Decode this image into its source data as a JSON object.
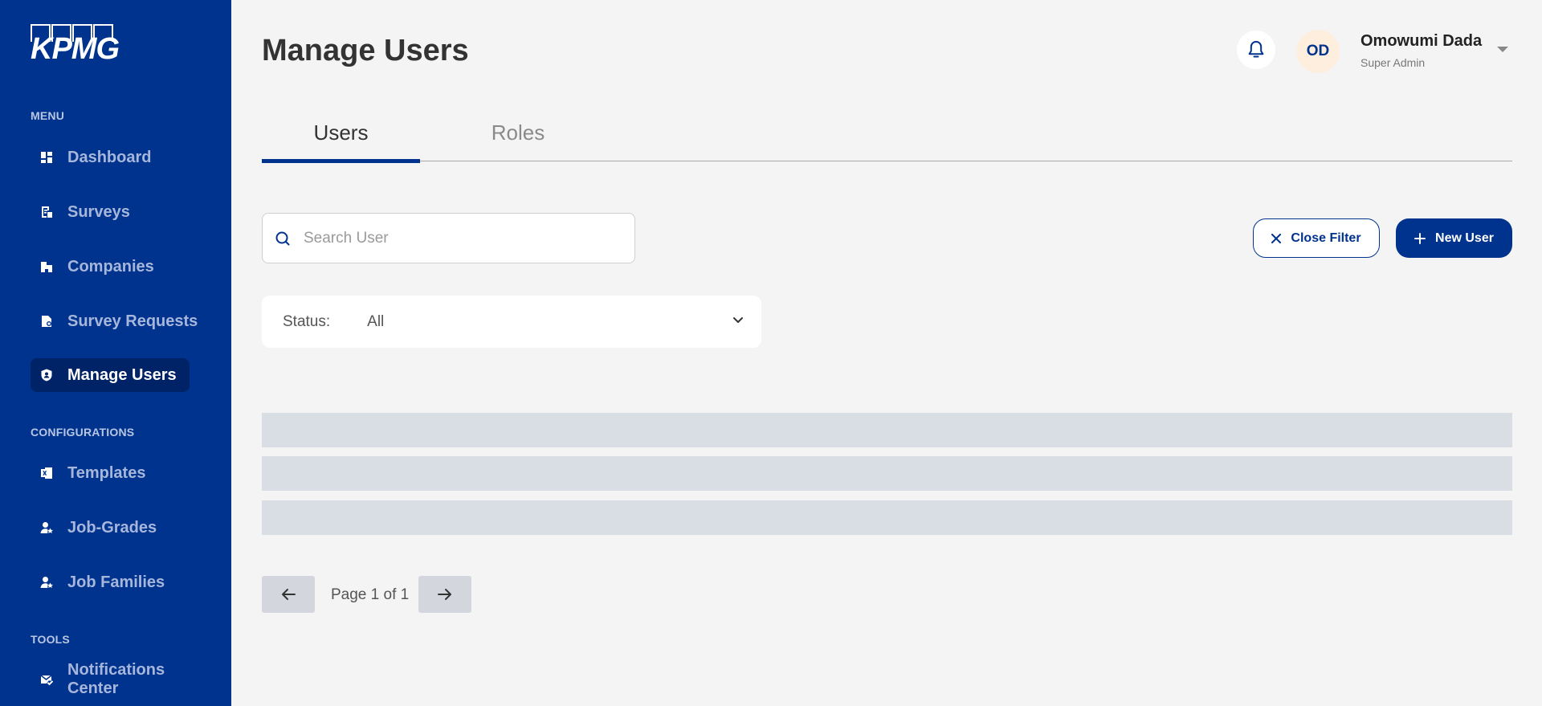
{
  "brand": {
    "logo_text": "KPMG"
  },
  "sidebar": {
    "sections": [
      {
        "label": "MENU"
      },
      {
        "label": "CONFIGURATIONS"
      },
      {
        "label": "TOOLS"
      }
    ],
    "items": [
      {
        "label": "Dashboard",
        "icon": "dashboard-icon"
      },
      {
        "label": "Surveys",
        "icon": "survey-icon"
      },
      {
        "label": "Companies",
        "icon": "building-icon"
      },
      {
        "label": "Survey Requests",
        "icon": "request-icon"
      },
      {
        "label": "Manage Users",
        "icon": "shield-user-icon",
        "active": true
      },
      {
        "label": "Templates",
        "icon": "excel-icon"
      },
      {
        "label": "Job-Grades",
        "icon": "user-star-icon"
      },
      {
        "label": "Job Families",
        "icon": "user-star-icon"
      },
      {
        "label": "Notifications Center",
        "icon": "mail-check-icon"
      }
    ]
  },
  "header": {
    "title": "Manage Users",
    "user": {
      "initials": "OD",
      "name": "Omowumi Dada",
      "role": "Super Admin"
    }
  },
  "tabs": [
    {
      "label": "Users",
      "active": true
    },
    {
      "label": "Roles",
      "active": false
    }
  ],
  "search": {
    "placeholder": "Search User",
    "value": ""
  },
  "actions": {
    "close_filter": "Close Filter",
    "new_user": "New User"
  },
  "filter": {
    "label": "Status:",
    "value": "All"
  },
  "pagination": {
    "text": "Page 1 of 1"
  },
  "colors": {
    "primary": "#00338d",
    "sidebar_active": "#002266",
    "background": "#f4f4f4",
    "skeleton": "#d9dee5"
  }
}
